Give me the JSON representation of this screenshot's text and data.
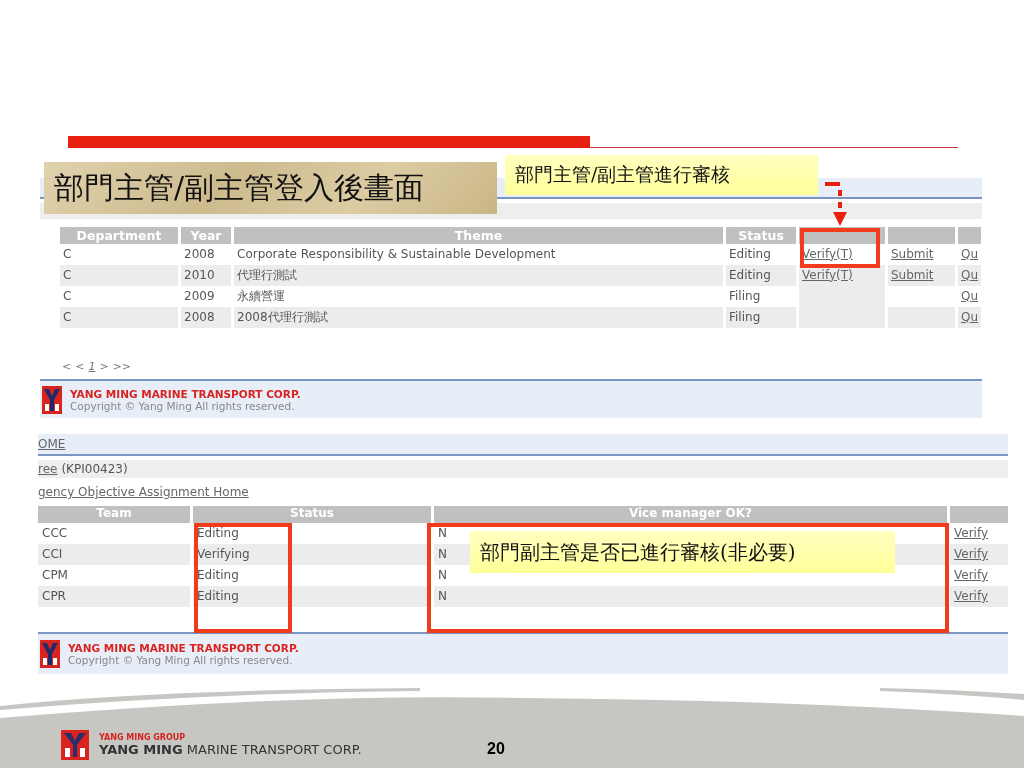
{
  "title_banner": "部門主管/副主管登入後畫面",
  "callouts": [
    {
      "text": "部門主管/副主管進行審核"
    },
    {
      "text": "部門副主管是否已進行審核(非必要)"
    }
  ],
  "screen_1": {
    "columns": [
      "Department",
      "Year",
      "Theme",
      "Status"
    ],
    "rows": [
      {
        "department": "C",
        "year": "2008",
        "theme": "Corporate Responsibility & Sustainable Development",
        "status": "Editing",
        "verify": "Verify(T)",
        "submit": "Submit",
        "column_7": "Qu"
      },
      {
        "department": "C",
        "year": "2010",
        "theme": "代理行測試",
        "status": "Editing",
        "verify": "Verify(T)",
        "submit": "Submit",
        "column_7": "Qu"
      },
      {
        "department": "C",
        "year": "2009",
        "theme": "永續營運",
        "status": "Filing",
        "column_7": "Qu"
      },
      {
        "department": "C",
        "year": "2008",
        "theme": "2008代理行測試",
        "status": "Filing",
        "column_7": "Qu"
      }
    ],
    "pagination": [
      {
        "label": "<",
        "selected": false
      },
      {
        "label": "<",
        "selected": false
      },
      {
        "label": "1",
        "selected": true
      },
      {
        "label": ">",
        "selected": false
      },
      {
        "label": ">>",
        "selected": false
      }
    ],
    "footer": {
      "company": "YANG MING MARINE TRANSPORT CORP.",
      "copyright": "Copyright © Yang Ming All rights reserved."
    }
  },
  "screen_2": {
    "home_link": "OME",
    "tree_link": "ree",
    "tree_code": "(KPI00423)",
    "assignment_link": "gency Objective Assignment Home",
    "columns": [
      "Team",
      "Status",
      "Vice manager OK?"
    ],
    "rows": [
      {
        "team": "CCC",
        "status": "Editing",
        "vice_manager_ok": "N",
        "action": "Verify"
      },
      {
        "team": "CCI",
        "status": "Verifying",
        "vice_manager_ok": "N",
        "action": "Verify"
      },
      {
        "team": "CPM",
        "status": "Editing",
        "vice_manager_ok": "N",
        "action": "Verify"
      },
      {
        "team": "CPR",
        "status": "Editing",
        "vice_manager_ok": "N",
        "action": "Verify"
      }
    ],
    "footer": {
      "company": "YANG MING MARINE TRANSPORT CORP.",
      "copyright": "Copyright © Yang Ming All rights reserved."
    }
  },
  "slide_footer": {
    "group": "YANG MING GROUP",
    "company": "**YANG MING** MARINE TRANSPORT CORP.",
    "page_number": "20"
  }
}
